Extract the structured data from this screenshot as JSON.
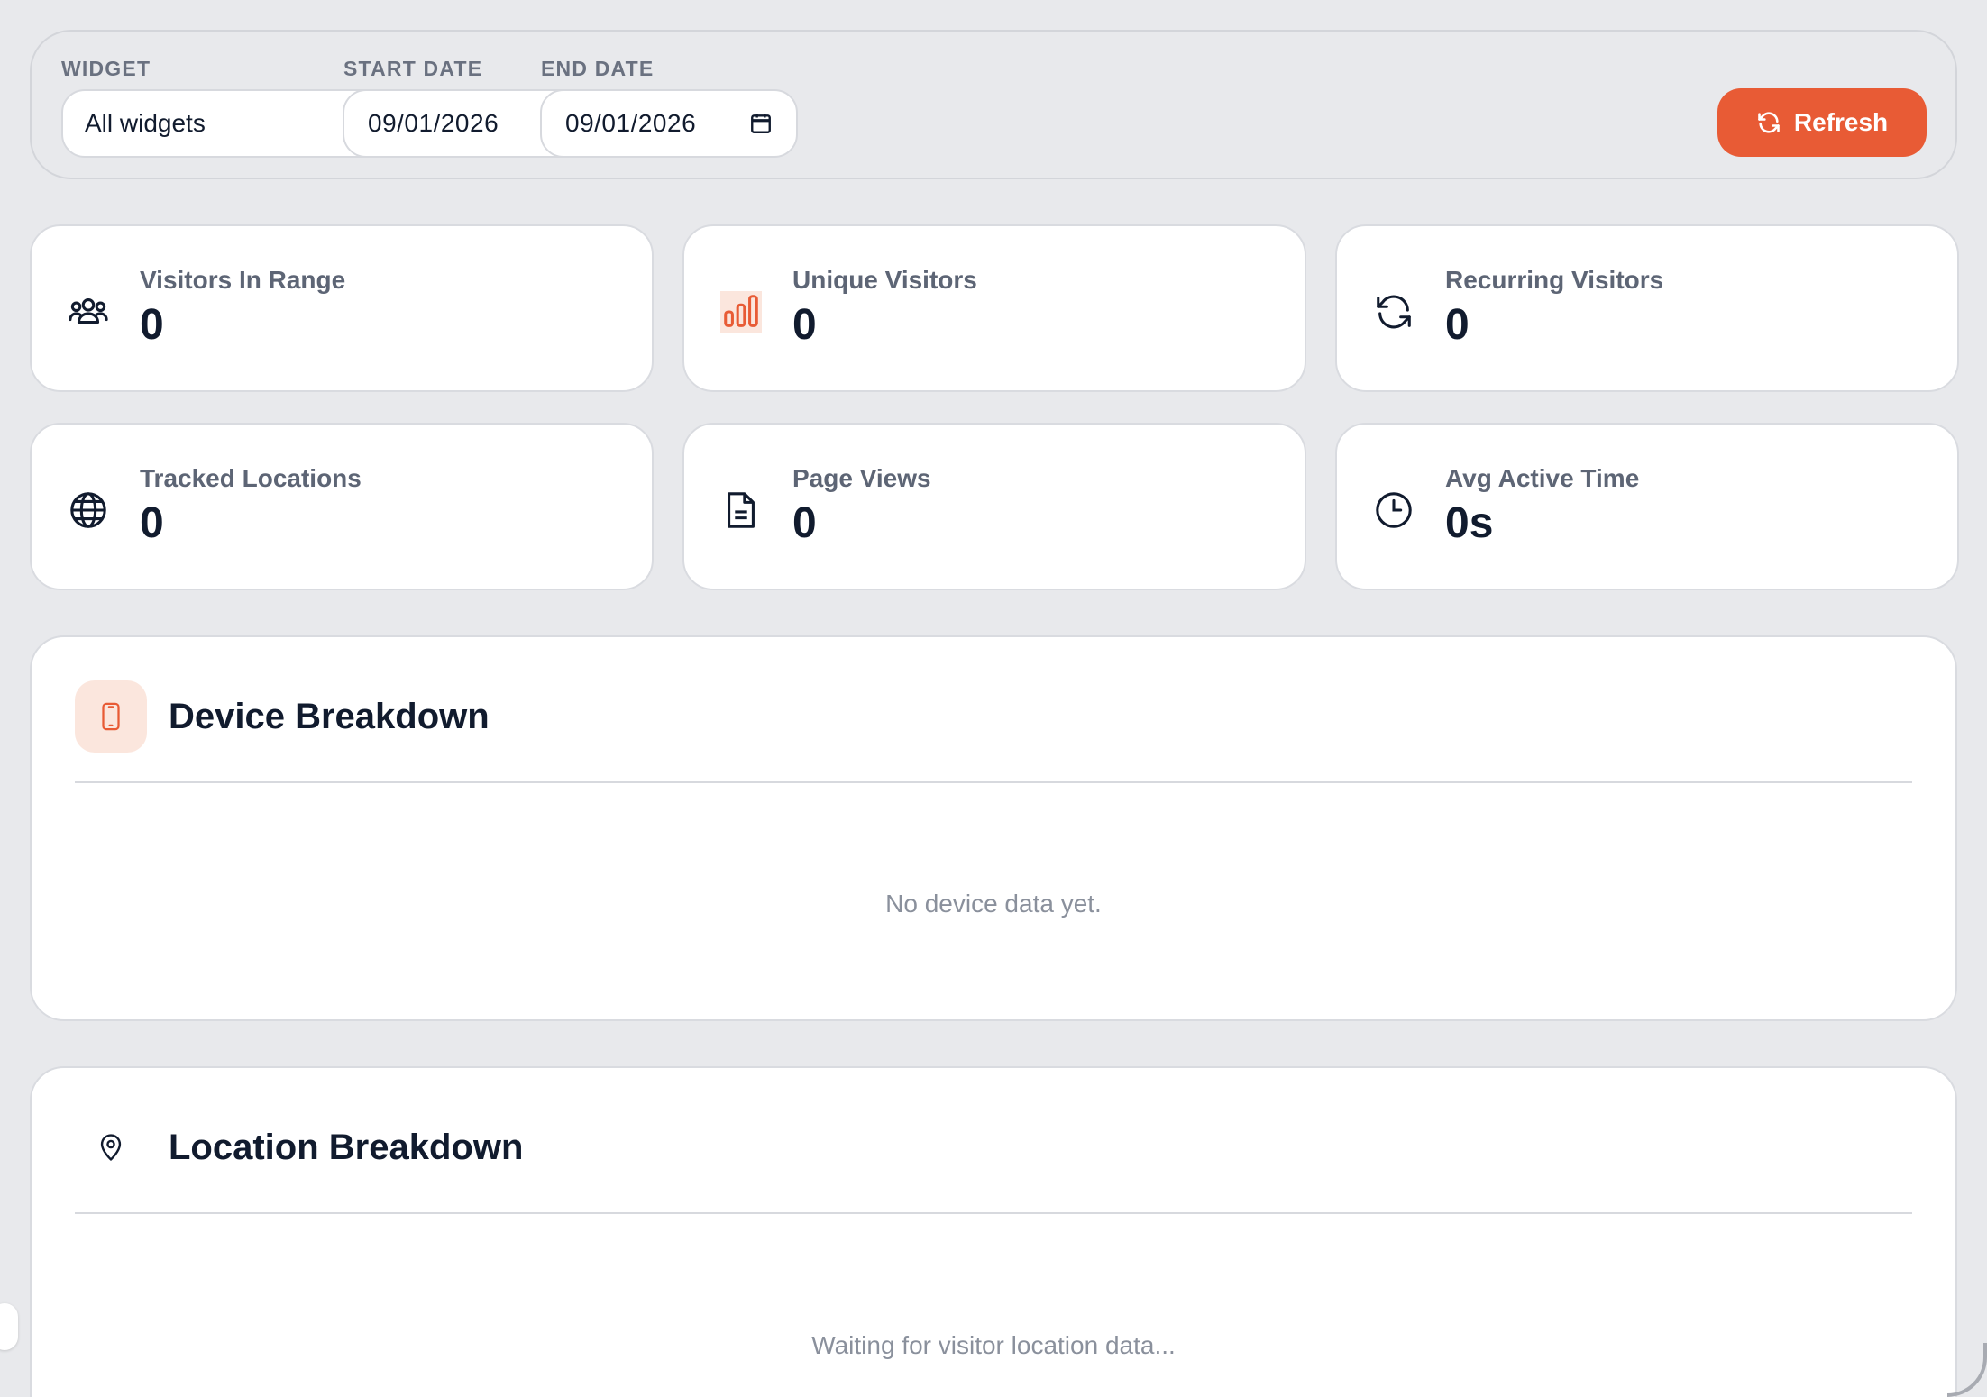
{
  "filters": {
    "widget_label": "WIDGET",
    "widget_value": "All widgets",
    "start_label": "START DATE",
    "start_value": "09/01/2026",
    "end_label": "END DATE",
    "end_value": "09/01/2026",
    "refresh_label": "Refresh"
  },
  "stats": [
    {
      "label": "Visitors In Range",
      "value": "0",
      "icon": "users-icon"
    },
    {
      "label": "Unique Visitors",
      "value": "0",
      "icon": "bar-chart-icon"
    },
    {
      "label": "Recurring Visitors",
      "value": "0",
      "icon": "refresh-icon"
    },
    {
      "label": "Tracked Locations",
      "value": "0",
      "icon": "globe-icon"
    },
    {
      "label": "Page Views",
      "value": "0",
      "icon": "document-icon"
    },
    {
      "label": "Avg Active Time",
      "value": "0s",
      "icon": "clock-icon"
    }
  ],
  "device": {
    "title": "Device Breakdown",
    "empty": "No device data yet.",
    "icon": "smartphone-icon"
  },
  "location": {
    "title": "Location Breakdown",
    "empty": "Waiting for visitor location data...",
    "icon": "map-pin-icon"
  },
  "colors": {
    "accent": "#e85b35",
    "accent_soft": "#fbe6dd",
    "background": "#e8e9ec",
    "text": "#111b2e"
  }
}
